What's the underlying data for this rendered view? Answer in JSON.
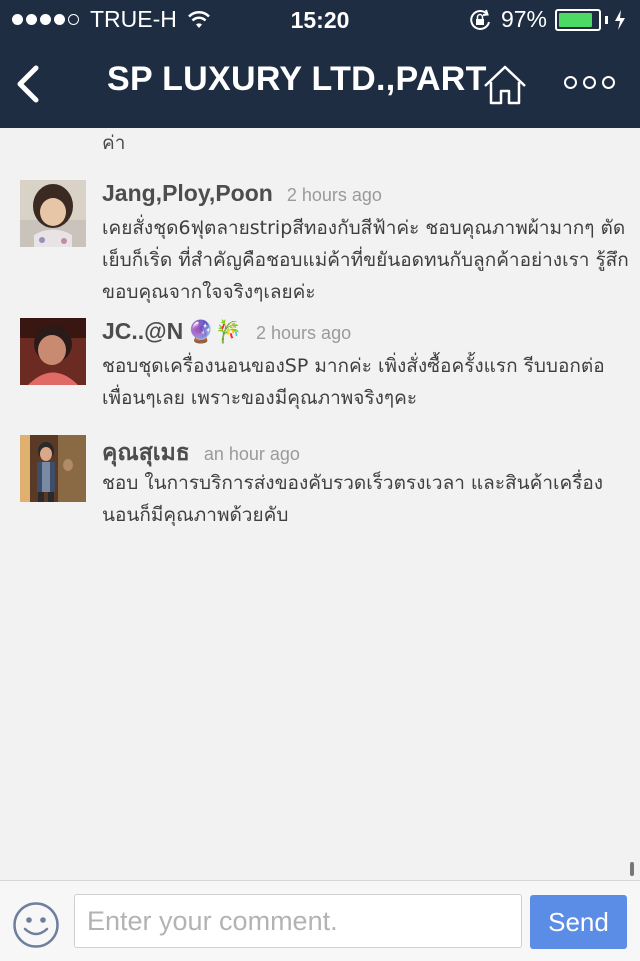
{
  "status_bar": {
    "carrier": "TRUE-H",
    "signal_bars": 4,
    "time": "15:20",
    "battery_percent": "97%",
    "battery_level": 0.97,
    "icons": [
      "signal-dots-icon",
      "wifi-icon",
      "orientation-lock-icon",
      "battery-icon",
      "charging-bolt-icon"
    ]
  },
  "navbar": {
    "title": "SP LUXURY LTD.,PART",
    "icons": [
      "back-chevron-icon",
      "home-icon",
      "more-dots-icon"
    ]
  },
  "feed": {
    "cut_off_text": "ค่า",
    "comments": [
      {
        "author": "Jang,Ploy,Poon",
        "time": "2 hours ago",
        "text": "เคยสั่งชุด6ฟุตลายstripสีทองกับสีฟ้าค่ะ ชอบคุณภาพผ้ามากๆ ตัดเย็บก็เริ่ด ที่สำคัญคือชอบแม่ค้าที่ขยันอดทนกับลูกค้าอย่างเรา รู้สึกขอบคุณจากใจจริงๆเลยค่ะ"
      },
      {
        "author": "JC..@N",
        "author_emoji": "🔮🎋",
        "time": "2 hours ago",
        "text": "ชอบชุดเครื่องนอนของSP มากค่ะ เพิ่งสั่งซื้อครั้งแรก รีบบอกต่อเพื่อนๆเลย เพราะของมีคุณภาพจริงๆคะ"
      },
      {
        "author": "คุณสุเมธ",
        "time": "an hour ago",
        "text": "ชอบ ในการบริการส่งของคับรวดเร็วตรงเวลา และสินค้าเครื่องนอนก็มีคุณภาพด้วยคับ"
      }
    ]
  },
  "input_bar": {
    "placeholder": "Enter your comment.",
    "value": "",
    "send_label": "Send",
    "icons": [
      "smiley-icon"
    ]
  },
  "colors": {
    "header_bg": "#1f2d43",
    "send_button": "#5b8de6",
    "battery_green": "#4cd964",
    "feed_bg": "#f2f2f3"
  }
}
